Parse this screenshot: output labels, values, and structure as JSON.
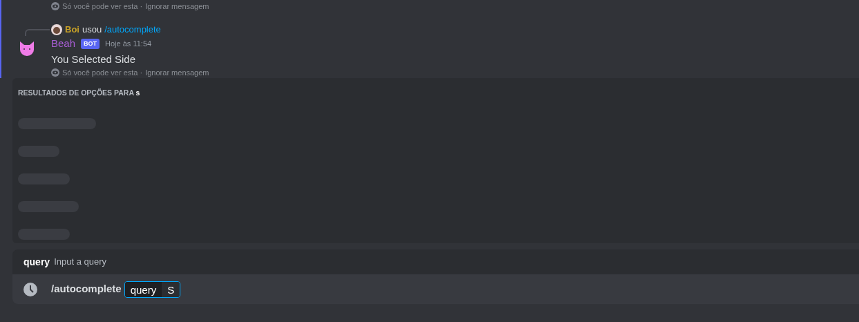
{
  "messages": [
    {
      "kind": "notice",
      "text": "Só você pode ver esta ·",
      "link": "Ignorar mensagem"
    },
    {
      "kind": "reply",
      "reply": {
        "user": "Boi",
        "verb": "usou",
        "command": "/autocomplete"
      },
      "author": "Beah",
      "badge": "BOT",
      "time": "Hoje às 11:54",
      "text": "You Selected Side",
      "notice": {
        "text": "Só você pode ver esta ·",
        "link": "Ignorar mensagem"
      }
    }
  ],
  "popup": {
    "title": "RESULTADOS DE OPÇÕES PARA",
    "query": "s",
    "loading": true
  },
  "option_hint": {
    "name": "query",
    "description": "Input a query"
  },
  "composer": {
    "command": "/autocomplete",
    "option": "query",
    "value": "S"
  }
}
